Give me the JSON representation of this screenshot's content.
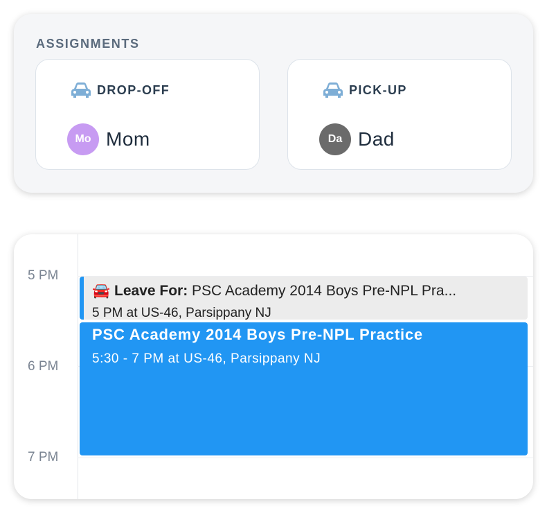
{
  "assignments": {
    "title": "ASSIGNMENTS",
    "dropoff": {
      "label": "DROP-OFF",
      "icon": "car-icon",
      "initials": "Mo",
      "name": "Mom",
      "avatar_color": "#c79bf2"
    },
    "pickup": {
      "label": "PICK-UP",
      "icon": "car-icon",
      "initials": "Da",
      "name": "Dad",
      "avatar_color": "#6b6b6b"
    }
  },
  "calendar": {
    "hours": [
      "5 PM",
      "6 PM",
      "7 PM"
    ],
    "events": [
      {
        "icon": "red-car-emoji",
        "prefix": "Leave For:",
        "title": "PSC Academy 2014 Boys Pre-NPL Pra...",
        "detail": "5 PM at US-46, Parsippany NJ",
        "color": "#ececec"
      },
      {
        "title": "PSC Academy 2014 Boys Pre-NPL Practice",
        "detail": "5:30 - 7 PM at US-46, Parsippany NJ",
        "color": "#2196f3"
      }
    ]
  },
  "colors": {
    "accent": "#2196f3",
    "car_icon": "#7eaed6"
  }
}
